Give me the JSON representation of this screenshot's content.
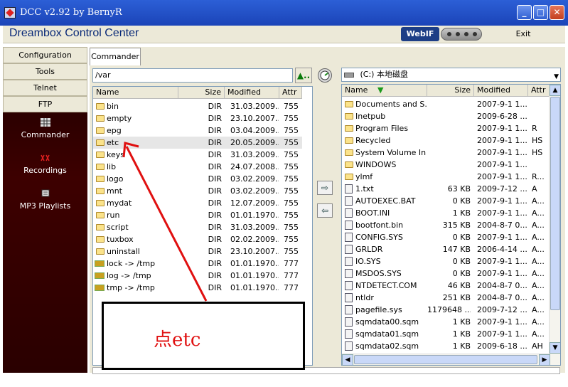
{
  "window": {
    "title": "DCC v2.92 by BernyR",
    "buttons": {
      "minimize": "_",
      "maximize": "□",
      "close": "✕"
    }
  },
  "header": {
    "app_title": "Dreambox Control Center",
    "webif_label": "WebIF",
    "exit_label": "Exit"
  },
  "nav": {
    "items": [
      "Configuration",
      "Tools",
      "Telnet",
      "FTP"
    ],
    "icon_items": [
      {
        "label": "Commander",
        "icon": "grid-icon"
      },
      {
        "label": "Recordings",
        "icon": "film-icon"
      },
      {
        "label": "MP3 Playlists",
        "icon": "playlist-icon"
      }
    ]
  },
  "tab": {
    "label": "Commander"
  },
  "left_panel": {
    "path": "/var",
    "columns": [
      "Name",
      "Size",
      "Modified",
      "Attr"
    ],
    "rows": [
      {
        "name": "bin",
        "size": "DIR",
        "modified": "31.03.2009...",
        "attr": "755",
        "type": "folder"
      },
      {
        "name": "empty",
        "size": "DIR",
        "modified": "23.10.2007...",
        "attr": "755",
        "type": "folder"
      },
      {
        "name": "epg",
        "size": "DIR",
        "modified": "03.04.2009...",
        "attr": "755",
        "type": "folder"
      },
      {
        "name": "etc",
        "size": "DIR",
        "modified": "20.05.2009...",
        "attr": "755",
        "type": "folder",
        "selected": true
      },
      {
        "name": "keys",
        "size": "DIR",
        "modified": "31.03.2009...",
        "attr": "755",
        "type": "folder"
      },
      {
        "name": "lib",
        "size": "DIR",
        "modified": "24.07.2008...",
        "attr": "755",
        "type": "folder"
      },
      {
        "name": "logo",
        "size": "DIR",
        "modified": "03.02.2009...",
        "attr": "755",
        "type": "folder"
      },
      {
        "name": "mnt",
        "size": "DIR",
        "modified": "03.02.2009...",
        "attr": "755",
        "type": "folder"
      },
      {
        "name": "mydat",
        "size": "DIR",
        "modified": "12.07.2009...",
        "attr": "755",
        "type": "folder"
      },
      {
        "name": "run",
        "size": "DIR",
        "modified": "01.01.1970...",
        "attr": "755",
        "type": "folder"
      },
      {
        "name": "script",
        "size": "DIR",
        "modified": "31.03.2009...",
        "attr": "755",
        "type": "folder"
      },
      {
        "name": "tuxbox",
        "size": "DIR",
        "modified": "02.02.2009...",
        "attr": "755",
        "type": "folder"
      },
      {
        "name": "uninstall",
        "size": "DIR",
        "modified": "23.10.2007...",
        "attr": "755",
        "type": "folder"
      },
      {
        "name": "lock -> /tmp",
        "size": "DIR",
        "modified": "01.01.1970...",
        "attr": "777",
        "type": "link"
      },
      {
        "name": "log -> /tmp",
        "size": "DIR",
        "modified": "01.01.1970...",
        "attr": "777",
        "type": "link"
      },
      {
        "name": "tmp -> /tmp",
        "size": "DIR",
        "modified": "01.01.1970...",
        "attr": "777",
        "type": "link"
      }
    ]
  },
  "right_panel": {
    "drive": "(C:) 本地磁盘",
    "columns": [
      "Name",
      "Size",
      "Modified",
      "Attr"
    ],
    "rows": [
      {
        "name": "Documents and S...",
        "size": "",
        "modified": "2007-9-1 1...",
        "attr": "",
        "type": "folder"
      },
      {
        "name": "Inetpub",
        "size": "",
        "modified": "2009-6-28 ...",
        "attr": "",
        "type": "folder"
      },
      {
        "name": "Program Files",
        "size": "",
        "modified": "2007-9-1 1...",
        "attr": "R",
        "type": "folder"
      },
      {
        "name": "Recycled",
        "size": "",
        "modified": "2007-9-1 1...",
        "attr": "HS",
        "type": "folder"
      },
      {
        "name": "System Volume In...",
        "size": "",
        "modified": "2007-9-1 1...",
        "attr": "HS",
        "type": "folder"
      },
      {
        "name": "WINDOWS",
        "size": "",
        "modified": "2007-9-1 1...",
        "attr": "",
        "type": "folder"
      },
      {
        "name": "ylmf",
        "size": "",
        "modified": "2007-9-1 1...",
        "attr": "R...",
        "type": "folder"
      },
      {
        "name": "1.txt",
        "size": "63 KB",
        "modified": "2009-7-12 ...",
        "attr": "A",
        "type": "file"
      },
      {
        "name": "AUTOEXEC.BAT",
        "size": "0 KB",
        "modified": "2007-9-1 1...",
        "attr": "A...",
        "type": "file"
      },
      {
        "name": "BOOT.INI",
        "size": "1 KB",
        "modified": "2007-9-1 1...",
        "attr": "A...",
        "type": "file"
      },
      {
        "name": "bootfont.bin",
        "size": "315 KB",
        "modified": "2004-8-7 0...",
        "attr": "A...",
        "type": "file"
      },
      {
        "name": "CONFIG.SYS",
        "size": "0 KB",
        "modified": "2007-9-1 1...",
        "attr": "A...",
        "type": "file"
      },
      {
        "name": "GRLDR",
        "size": "147 KB",
        "modified": "2006-4-14 ...",
        "attr": "A...",
        "type": "file"
      },
      {
        "name": "IO.SYS",
        "size": "0 KB",
        "modified": "2007-9-1 1...",
        "attr": "A...",
        "type": "file"
      },
      {
        "name": "MSDOS.SYS",
        "size": "0 KB",
        "modified": "2007-9-1 1...",
        "attr": "A...",
        "type": "file"
      },
      {
        "name": "NTDETECT.COM",
        "size": "46 KB",
        "modified": "2004-8-7 0...",
        "attr": "A...",
        "type": "file"
      },
      {
        "name": "ntldr",
        "size": "251 KB",
        "modified": "2004-8-7 0...",
        "attr": "A...",
        "type": "file"
      },
      {
        "name": "pagefile.sys",
        "size": "1179648 ...",
        "modified": "2009-7-12 ...",
        "attr": "A...",
        "type": "file"
      },
      {
        "name": "sqmdata00.sqm",
        "size": "1 KB",
        "modified": "2007-9-1 1...",
        "attr": "A...",
        "type": "file"
      },
      {
        "name": "sqmdata01.sqm",
        "size": "1 KB",
        "modified": "2007-9-1 1...",
        "attr": "A...",
        "type": "file"
      },
      {
        "name": "sqmdata02.sqm",
        "size": "1 KB",
        "modified": "2009-6-18 ...",
        "attr": "AH",
        "type": "file"
      }
    ]
  },
  "annotation": {
    "text": "点etc",
    "color": "#e01010"
  },
  "colors": {
    "titlebar": "#1b44b8",
    "nav_background": "#2a0000",
    "panel_background": "#ece9d8"
  }
}
